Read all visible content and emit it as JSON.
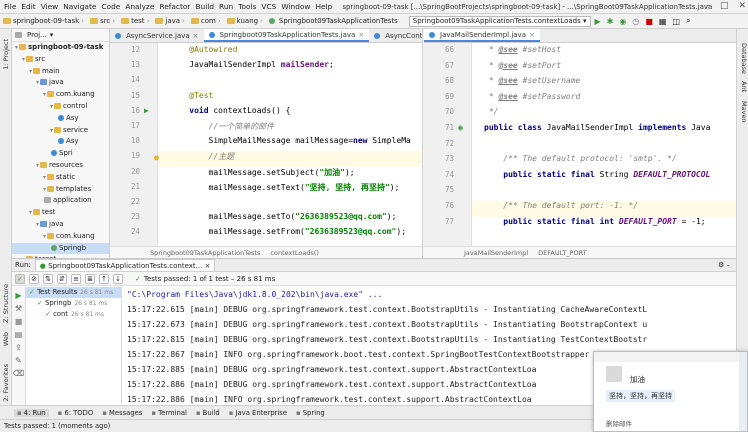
{
  "menu": [
    "File",
    "Edit",
    "View",
    "Navigate",
    "Code",
    "Analyze",
    "Refactor",
    "Build",
    "Run",
    "Tools",
    "VCS",
    "Window",
    "Help"
  ],
  "window_title": "springboot-09-task [...\\SpringBootProjects\\springboot-09-task] - ...\\SpringBoot09TaskApplicationTests.java",
  "breadcrumbs": [
    "springboot-09-task",
    "src",
    "test",
    "java",
    "com",
    "kuang",
    "Springboot09TaskApplicationTests"
  ],
  "run_config": "Springboot09TaskApplicationTests.contextLoads",
  "left_strip": [
    "1: Project",
    "Z: Structure",
    "Web",
    "2: Favorites"
  ],
  "right_strip": [
    "Database",
    "Ant",
    "Maven"
  ],
  "project": {
    "title": "Proj...",
    "items": [
      {
        "label": "springboot-09-task",
        "icon": "folder",
        "indent": 0,
        "bold": true
      },
      {
        "label": "src",
        "icon": "folder",
        "indent": 1
      },
      {
        "label": "main",
        "icon": "folder",
        "indent": 2
      },
      {
        "label": "java",
        "icon": "folder-blue",
        "indent": 3
      },
      {
        "label": "com.kuang",
        "icon": "folder",
        "indent": 4
      },
      {
        "label": "control",
        "icon": "folder",
        "indent": 5
      },
      {
        "label": "Asy",
        "icon": "class",
        "indent": 6
      },
      {
        "label": "service",
        "icon": "folder",
        "indent": 5
      },
      {
        "label": "Asy",
        "icon": "class",
        "indent": 6
      },
      {
        "label": "Spri",
        "icon": "class",
        "indent": 5
      },
      {
        "label": "resources",
        "icon": "folder",
        "indent": 3
      },
      {
        "label": "static",
        "icon": "folder",
        "indent": 4
      },
      {
        "label": "templates",
        "icon": "folder",
        "indent": 4
      },
      {
        "label": "application",
        "icon": "file",
        "indent": 4
      },
      {
        "label": "test",
        "icon": "folder",
        "indent": 2
      },
      {
        "label": "java",
        "icon": "folder-blue",
        "indent": 3
      },
      {
        "label": "com.kuang",
        "icon": "folder",
        "indent": 4
      },
      {
        "label": "Springb",
        "icon": "test",
        "indent": 5,
        "selected": true
      },
      {
        "label": "target",
        "icon": "folder",
        "indent": 1
      },
      {
        "label": ".gitignore",
        "icon": "file",
        "indent": 1
      }
    ]
  },
  "editor1": {
    "tabs": [
      {
        "label": "AsyncService.java",
        "active": false
      },
      {
        "label": "Springboot09TaskApplicationTests.java",
        "active": true
      },
      {
        "label": "AsyncControll",
        "active": false
      }
    ],
    "breadcrumb": [
      "Springboot09TaskApplicationTests",
      "contextLoads()"
    ],
    "lines": [
      {
        "n": "12",
        "parts": [
          {
            "t": "    @Autowired",
            "c": "an"
          }
        ]
      },
      {
        "n": "13",
        "parts": [
          {
            "t": "    JavaMailSenderImpl ",
            "c": ""
          },
          {
            "t": "mailSender",
            "c": "fld"
          },
          {
            "t": ";",
            "c": ""
          }
        ]
      },
      {
        "n": "14",
        "parts": []
      },
      {
        "n": "15",
        "parts": [
          {
            "t": "    @Test",
            "c": "an"
          }
        ]
      },
      {
        "n": "16",
        "parts": [
          {
            "t": "    ",
            "c": ""
          },
          {
            "t": "void",
            "c": "kw"
          },
          {
            "t": " contextLoads() {",
            "c": ""
          }
        ]
      },
      {
        "n": "17",
        "parts": [
          {
            "t": "        //一个简单的邮件",
            "c": "cm"
          }
        ]
      },
      {
        "n": "18",
        "parts": [
          {
            "t": "        SimpleMailMessage mailMessage=",
            "c": ""
          },
          {
            "t": "new",
            "c": "kw"
          },
          {
            "t": " SimpleMa",
            "c": ""
          }
        ]
      },
      {
        "n": "19",
        "parts": [
          {
            "t": "        //主题",
            "c": "cm"
          }
        ],
        "hl": true
      },
      {
        "n": "20",
        "parts": [
          {
            "t": "        mailMessage.setSubject(",
            "c": ""
          },
          {
            "t": "\"加油\"",
            "c": "st"
          },
          {
            "t": ");",
            "c": ""
          }
        ]
      },
      {
        "n": "21",
        "parts": [
          {
            "t": "        mailMessage.setText(",
            "c": ""
          },
          {
            "t": "\"坚持, 坚持, 再坚持\"",
            "c": "st"
          },
          {
            "t": ");",
            "c": ""
          }
        ]
      },
      {
        "n": "22",
        "parts": []
      },
      {
        "n": "23",
        "parts": [
          {
            "t": "        mailMessage.setTo(",
            "c": ""
          },
          {
            "t": "\"2636389523@qq.com\"",
            "c": "st"
          },
          {
            "t": ");",
            "c": ""
          }
        ]
      },
      {
        "n": "24",
        "parts": [
          {
            "t": "        mailMessage.setFrom(",
            "c": ""
          },
          {
            "t": "\"2636389523@qq.com\"",
            "c": "st"
          },
          {
            "t": ");",
            "c": ""
          }
        ]
      }
    ]
  },
  "editor2": {
    "tabs": [
      {
        "label": "JavaMailSenderImpl.java",
        "active": true
      }
    ],
    "breadcrumb": [
      "JavaMailSenderImpl",
      "DEFAULT_PORT"
    ],
    "lines": [
      {
        "n": "66",
        "parts": [
          {
            "t": " * ",
            "c": "jd"
          },
          {
            "t": "@see",
            "c": "jdt"
          },
          {
            "t": " #setHost",
            "c": "jd"
          }
        ]
      },
      {
        "n": "67",
        "parts": [
          {
            "t": " * ",
            "c": "jd"
          },
          {
            "t": "@see",
            "c": "jdt"
          },
          {
            "t": " #setPort",
            "c": "jd"
          }
        ]
      },
      {
        "n": "68",
        "parts": [
          {
            "t": " * ",
            "c": "jd"
          },
          {
            "t": "@see",
            "c": "jdt"
          },
          {
            "t": " #setUsername",
            "c": "jd"
          }
        ]
      },
      {
        "n": "69",
        "parts": [
          {
            "t": " * ",
            "c": "jd"
          },
          {
            "t": "@see",
            "c": "jdt"
          },
          {
            "t": " #setPassword",
            "c": "jd"
          }
        ]
      },
      {
        "n": "70",
        "parts": [
          {
            "t": " */",
            "c": "jd"
          }
        ]
      },
      {
        "n": "71",
        "parts": [
          {
            "t": "public class",
            "c": "kw"
          },
          {
            "t": " JavaMailSenderImpl ",
            "c": ""
          },
          {
            "t": "implements",
            "c": "kw"
          },
          {
            "t": " Java",
            "c": ""
          }
        ]
      },
      {
        "n": "72",
        "parts": []
      },
      {
        "n": "73",
        "parts": [
          {
            "t": "    /** The default protocol: 'smtp'. */",
            "c": "jd"
          }
        ]
      },
      {
        "n": "74",
        "parts": [
          {
            "t": "    ",
            "c": ""
          },
          {
            "t": "public static final",
            "c": "kw"
          },
          {
            "t": " String ",
            "c": ""
          },
          {
            "t": "DEFAULT_PROTOCOL",
            "c": "cst"
          }
        ]
      },
      {
        "n": "75",
        "parts": []
      },
      {
        "n": "76",
        "parts": [
          {
            "t": "    /** The default port: -1. */",
            "c": "jd"
          }
        ],
        "hl": true
      },
      {
        "n": "77",
        "parts": [
          {
            "t": "    ",
            "c": ""
          },
          {
            "t": "public static final int",
            "c": "kw"
          },
          {
            "t": " ",
            "c": ""
          },
          {
            "t": "DEFAULT_PORT",
            "c": "cst"
          },
          {
            "t": " = -1;",
            "c": ""
          }
        ]
      }
    ]
  },
  "run": {
    "label": "Run:",
    "tab": "Springboot09TaskApplicationTests.context...",
    "status": "Tests passed: 1 of 1 test – 26 s 81 ms",
    "tree": [
      {
        "label": "Test Results",
        "time": "26 s 81 ms",
        "indent": 0,
        "selected": true
      },
      {
        "label": "Springb",
        "time": "26 s 81 ms",
        "indent": 1
      },
      {
        "label": "cont",
        "time": "26 s 81 ms",
        "indent": 2
      }
    ],
    "console": [
      "\"C:\\Program Files\\Java\\jdk1.8.0_202\\bin\\java.exe\" ...",
      "15:17:22.615 [main] DEBUG org.springframework.test.context.BootstrapUtils - Instantiating CacheAwareContextL",
      "15:17:22.673 [main] DEBUG org.springframework.test.context.BootstrapUtils - Instantiating BootstrapContext u",
      "15:17:22.815 [main] DEBUG org.springframework.test.context.BootstrapUtils - Instantiating TestContextBootstr",
      "15:17:22.867 [main] INFO org.springframework.boot.test.context.SpringBootTestContextBootstrapper - Neither @",
      "15:17:22.885 [main] DEBUG org.springframework.test.context.support.AbstractContextLoa",
      "15:17:22.886 [main] DEBUG org.springframework.test.context.support.AbstractContextLoa",
      "15:17:22.886 [main] INFO org.springframework.test.context.support.AbstractContextLoa"
    ]
  },
  "bottom_tabs": [
    "4: Run",
    "6: TODO",
    "Messages",
    "Terminal",
    "Build",
    "Java Enterprise",
    "Spring"
  ],
  "status_text": "Tests passed: 1 (moments ago)",
  "popup": {
    "sender": "加油",
    "message": "坚持，坚持，再坚持",
    "footer": "删除邮件"
  }
}
